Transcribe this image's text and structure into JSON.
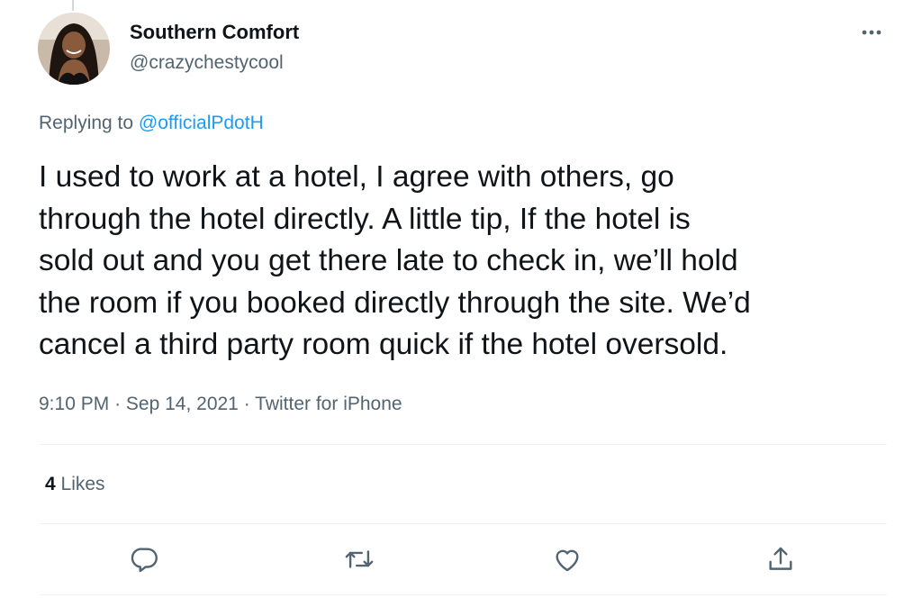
{
  "author": {
    "display_name": "Southern Comfort",
    "handle": "@crazychestycool"
  },
  "reply_context": {
    "prefix": "Replying to",
    "mention": "@officialPdotH"
  },
  "tweet": {
    "text": "I used to work at a hotel, I agree with others, go\nthrough the hotel directly.  A little tip, If the hotel is\nsold out and you get there late to check in, we’ll hold\nthe room if you booked directly through the site.  We’d\ncancel a third party room quick if the hotel oversold."
  },
  "meta": {
    "time": "9:10 PM",
    "separator": "·",
    "date": "Sep 14, 2021",
    "source": "Twitter for iPhone"
  },
  "stats": {
    "likes_count": "4",
    "likes_label": "Likes"
  },
  "actions": [
    "reply-icon",
    "retweet-icon",
    "like-icon",
    "share-icon"
  ],
  "colors": {
    "text_primary": "#0f1419",
    "text_secondary": "#536471",
    "link": "#1d9bf0",
    "divider": "#eff3f4"
  }
}
